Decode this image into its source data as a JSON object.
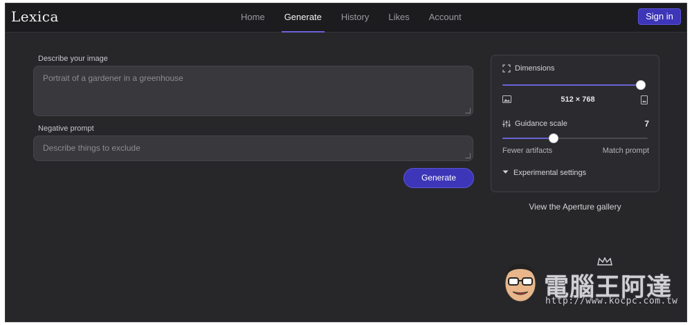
{
  "app": {
    "logo": "Lexica"
  },
  "nav": {
    "items": [
      {
        "label": "Home"
      },
      {
        "label": "Generate"
      },
      {
        "label": "History"
      },
      {
        "label": "Likes"
      },
      {
        "label": "Account"
      }
    ],
    "active": "Generate",
    "signin_label": "Sign in"
  },
  "form": {
    "prompt_label": "Describe your image",
    "prompt_placeholder": "Portrait of a gardener in a greenhouse",
    "negative_label": "Negative prompt",
    "negative_placeholder": "Describe things to exclude",
    "generate_label": "Generate"
  },
  "panel": {
    "dimensions_label": "Dimensions",
    "dimensions_slider_fraction": 1.0,
    "dimensions_value": "512 × 768",
    "guidance_label": "Guidance scale",
    "guidance_value": "7",
    "guidance_slider_fraction": 0.35,
    "fewer_label": "Fewer artifacts",
    "match_label": "Match prompt",
    "experimental_label": "Experimental settings"
  },
  "gallery_link": "View the Aperture gallery",
  "watermark": {
    "text": "電腦王阿達",
    "url": "http://www.kocpc.com.tw"
  },
  "colors": {
    "accent": "#3d36b8",
    "background": "#27272a",
    "header": "#1c1c1f"
  }
}
